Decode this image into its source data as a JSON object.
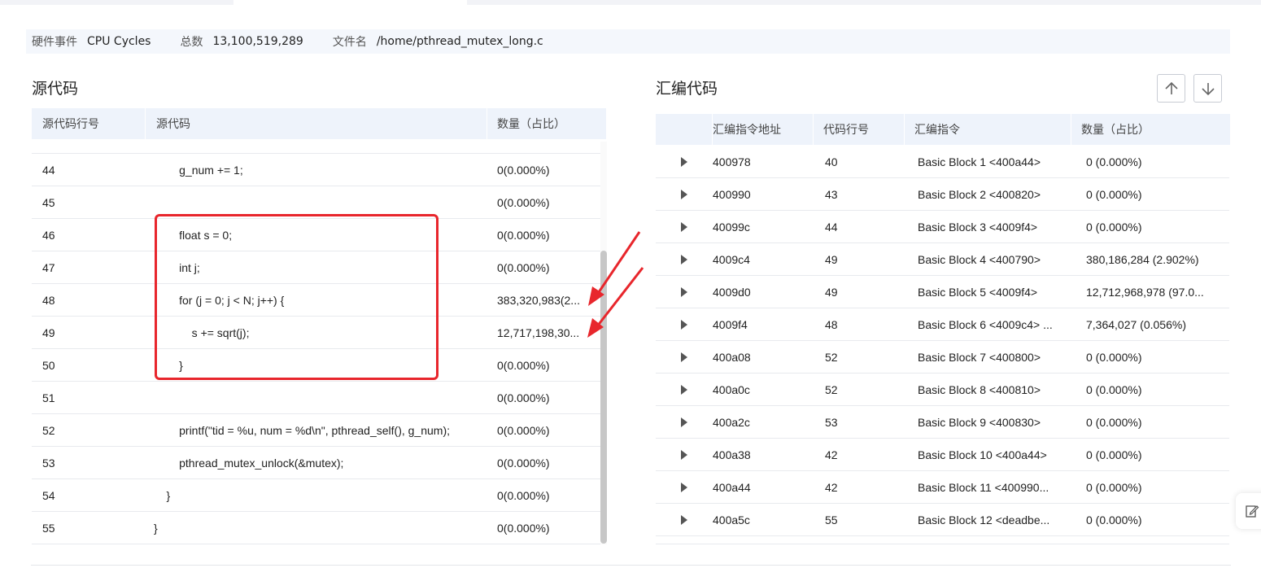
{
  "info_bar": {
    "event_label": "硬件事件",
    "event_value": "CPU Cycles",
    "total_label": "总数",
    "total_value": "13,100,519,289",
    "file_label": "文件名",
    "file_value": "/home/pthread_mutex_long.c"
  },
  "source_panel": {
    "title": "源代码",
    "columns": [
      "源代码行号",
      "源代码",
      "数量（占比）"
    ],
    "rows": [
      {
        "line": "44",
        "code": "        g_num += 1;",
        "count": "0(0.000%)"
      },
      {
        "line": "45",
        "code": "",
        "count": "0(0.000%)"
      },
      {
        "line": "46",
        "code": "        float s = 0;",
        "count": "0(0.000%)"
      },
      {
        "line": "47",
        "code": "        int j;",
        "count": "0(0.000%)"
      },
      {
        "line": "48",
        "code": "        for (j = 0; j < N; j++) {",
        "count": "383,320,983(2..."
      },
      {
        "line": "49",
        "code": "            s += sqrt(j);",
        "count": "12,717,198,30..."
      },
      {
        "line": "50",
        "code": "        }",
        "count": "0(0.000%)"
      },
      {
        "line": "51",
        "code": "",
        "count": "0(0.000%)"
      },
      {
        "line": "52",
        "code": "        printf(\"tid = %u, num = %d\\n\", pthread_self(), g_num);",
        "count": "0(0.000%)"
      },
      {
        "line": "53",
        "code": "        pthread_mutex_unlock(&mutex);",
        "count": "0(0.000%)"
      },
      {
        "line": "54",
        "code": "    }",
        "count": "0(0.000%)"
      },
      {
        "line": "55",
        "code": "}",
        "count": "0(0.000%)"
      }
    ]
  },
  "asm_panel": {
    "title": "汇编代码",
    "columns": [
      "汇编指令地址",
      "代码行号",
      "汇编指令",
      "数量（占比）"
    ],
    "rows": [
      {
        "addr": "400978",
        "line": "40",
        "instr": "Basic Block 1 <400a44>",
        "count": "0  (0.000%)"
      },
      {
        "addr": "400990",
        "line": "43",
        "instr": "Basic Block 2 <400820>",
        "count": "0  (0.000%)"
      },
      {
        "addr": "40099c",
        "line": "44",
        "instr": "Basic Block 3 <4009f4>",
        "count": "0  (0.000%)"
      },
      {
        "addr": "4009c4",
        "line": "49",
        "instr": "Basic Block 4 <400790>",
        "count": "380,186,284  (2.902%)"
      },
      {
        "addr": "4009d0",
        "line": "49",
        "instr": "Basic Block 5 <4009f4>",
        "count": "12,712,968,978  (97.0..."
      },
      {
        "addr": "4009f4",
        "line": "48",
        "instr": "Basic Block 6 <4009c4> ...",
        "count": "7,364,027  (0.056%)"
      },
      {
        "addr": "400a08",
        "line": "52",
        "instr": "Basic Block 7 <400800>",
        "count": "0  (0.000%)"
      },
      {
        "addr": "400a0c",
        "line": "52",
        "instr": "Basic Block 8 <400810>",
        "count": "0  (0.000%)"
      },
      {
        "addr": "400a2c",
        "line": "53",
        "instr": "Basic Block 9 <400830>",
        "count": "0  (0.000%)"
      },
      {
        "addr": "400a38",
        "line": "42",
        "instr": "Basic Block 10 <400a44>",
        "count": "0  (0.000%)"
      },
      {
        "addr": "400a44",
        "line": "42",
        "instr": "Basic Block 11 <400990...",
        "count": "0  (0.000%)"
      },
      {
        "addr": "400a5c",
        "line": "55",
        "instr": "Basic Block 12 <deadbe...",
        "count": "0  (0.000%)"
      }
    ]
  },
  "icons": {
    "up": "arrow-up-icon",
    "down": "arrow-down-icon",
    "expand": "caret-right-icon",
    "feedback": "edit-icon"
  },
  "colors": {
    "annotation_red": "#e8262c",
    "header_bg": "#eef3fb",
    "info_bg": "#f4f7fc"
  }
}
